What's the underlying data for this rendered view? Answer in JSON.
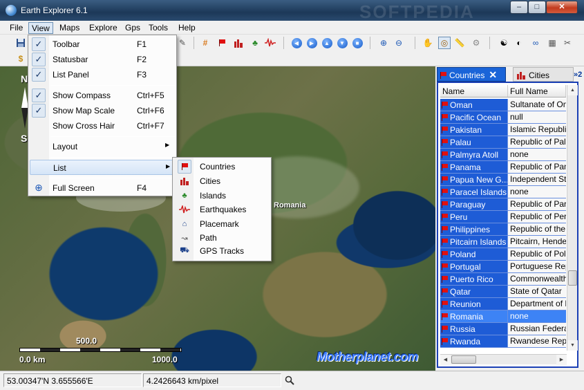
{
  "window": {
    "title": "Earth Explorer 6.1",
    "watermark": "SOFTPEDIA",
    "min_label": "–",
    "max_label": "□",
    "close_label": "✕"
  },
  "menubar": {
    "items": [
      "File",
      "View",
      "Maps",
      "Explore",
      "Gps",
      "Tools",
      "Help"
    ]
  },
  "view_menu": {
    "items": [
      {
        "label": "Toolbar",
        "key": "F1",
        "checked": true
      },
      {
        "label": "Statusbar",
        "key": "F2",
        "checked": true
      },
      {
        "label": "List Panel",
        "key": "F3",
        "checked": true
      },
      {
        "label": "Show Compass",
        "key": "Ctrl+F5",
        "checked": true
      },
      {
        "label": "Show Map Scale",
        "key": "Ctrl+F6",
        "checked": true
      },
      {
        "label": "Show Cross Hair",
        "key": "Ctrl+F7",
        "checked": false
      },
      {
        "label": "Layout",
        "key": "",
        "submenu": true
      },
      {
        "label": "List",
        "key": "",
        "submenu": true
      },
      {
        "label": "Full Screen",
        "key": "F4",
        "checked": false
      }
    ]
  },
  "list_submenu": {
    "items": [
      "Countries",
      "Cities",
      "Islands",
      "Earthquakes",
      "Placemark",
      "Path",
      "GPS Tracks"
    ]
  },
  "map": {
    "label": "Romania",
    "compass_n": "N",
    "compass_s": "S",
    "scale_top": "500.0",
    "scale_left": "0.0 km",
    "scale_right": "1000.0",
    "logo": "Motherplanet.com"
  },
  "panel": {
    "tab_countries": "Countries",
    "tab_cities": "Cities",
    "tab_more": "»2",
    "col_name": "Name",
    "col_fullname": "Full Name",
    "rows": [
      {
        "name": "Oman",
        "full": "Sultanate of Oman"
      },
      {
        "name": "Pacific Ocean",
        "full": "null"
      },
      {
        "name": "Pakistan",
        "full": "Islamic Republic of Pakistan"
      },
      {
        "name": "Palau",
        "full": "Republic of Palau"
      },
      {
        "name": "Palmyra Atoll",
        "full": "none"
      },
      {
        "name": "Panama",
        "full": "Republic of Panama"
      },
      {
        "name": "Papua New G...",
        "full": "Independent State of Papua New Guinea"
      },
      {
        "name": "Paracel Islands",
        "full": "none"
      },
      {
        "name": "Paraguay",
        "full": "Republic of Paraguay"
      },
      {
        "name": "Peru",
        "full": "Republic of Peru"
      },
      {
        "name": "Philippines",
        "full": "Republic of the Philippines"
      },
      {
        "name": "Pitcairn Islands",
        "full": "Pitcairn, Henderson"
      },
      {
        "name": "Poland",
        "full": "Republic of Poland"
      },
      {
        "name": "Portugal",
        "full": "Portuguese Republic"
      },
      {
        "name": "Puerto Rico",
        "full": "Commonwealth of Puerto Rico"
      },
      {
        "name": "Qatar",
        "full": "State of Qatar"
      },
      {
        "name": "Reunion",
        "full": "Department of Reunion"
      },
      {
        "name": "Romania",
        "full": "none",
        "selected": true
      },
      {
        "name": "Russia",
        "full": "Russian Federation"
      },
      {
        "name": "Rwanda",
        "full": "Rwandese Republic"
      }
    ]
  },
  "status": {
    "coords": "53.00347'N  3.655566'E",
    "scale": "4.2426643 km/pixel"
  },
  "colors": {
    "accent": "#1e5cd6",
    "flag": "#e01010"
  }
}
